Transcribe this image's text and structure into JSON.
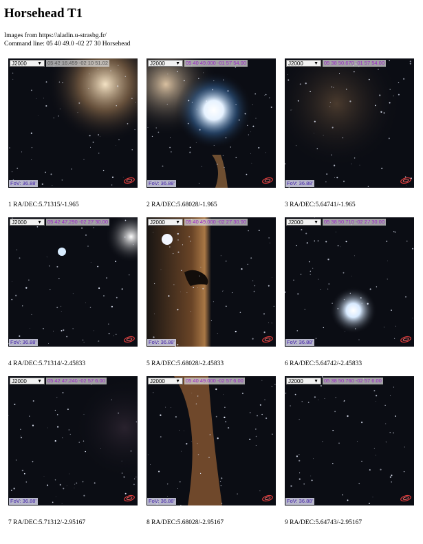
{
  "page": {
    "title": "Horsehead T1",
    "source_line": "Images from https://aladin.u-strasbg.fr/",
    "command_line": "Command line: 05 40 49.0 -02 27 30 Horsehead"
  },
  "colors": {
    "coord_text": "#9b27c9",
    "fov_text": "#3d1aa8",
    "sky": "#0b0d14"
  },
  "cells": [
    {
      "frame": "J2000",
      "coord": "05 43 16.459 -02 10 51.02",
      "fov": "FoV: 36.88'",
      "caption": "1 RA/DEC:5.71315/-1.965"
    },
    {
      "frame": "J2000",
      "coord": "05 40 49.000 -01 57 54.00",
      "fov": "FoV: 36.88'",
      "caption": "2 RA/DEC:5.68028/-1.965"
    },
    {
      "frame": "J2000",
      "coord": "05 38 50.670 -01 57 54.00",
      "fov": "FoV: 36.88'",
      "caption": "3 RA/DEC:5.64741/-1.965"
    },
    {
      "frame": "J2000",
      "coord": "05 42 47.290 -02 27 30.00",
      "fov": "FoV: 36.88'",
      "caption": "4 RA/DEC:5.71314/-2.45833"
    },
    {
      "frame": "J2000",
      "coord": "05 40 49.000 -02 27 30.00",
      "fov": "FoV: 36.88'",
      "caption": "5 RA/DEC:5.68028/-2.45833"
    },
    {
      "frame": "J2000",
      "coord": "05 38 50.710 -02 27 30.00",
      "fov": "FoV: 36.88'",
      "caption": "6 RA/DEC:5.64742/-2.45833"
    },
    {
      "frame": "J2000",
      "coord": "05 42 47.240 -02 57 6.00",
      "fov": "FoV: 36.88'",
      "caption": "7 RA/DEC:5.71312/-2.95167"
    },
    {
      "frame": "J2000",
      "coord": "05 40 49.000 -02 57 6.00",
      "fov": "FoV: 36.88'",
      "caption": "8 RA/DEC:5.68028/-2.95167"
    },
    {
      "frame": "J2000",
      "coord": "05 38 50.760 -02 57 6.00",
      "fov": "FoV: 36.88'",
      "caption": "9 RA/DEC:5.64743/-2.95167"
    }
  ]
}
